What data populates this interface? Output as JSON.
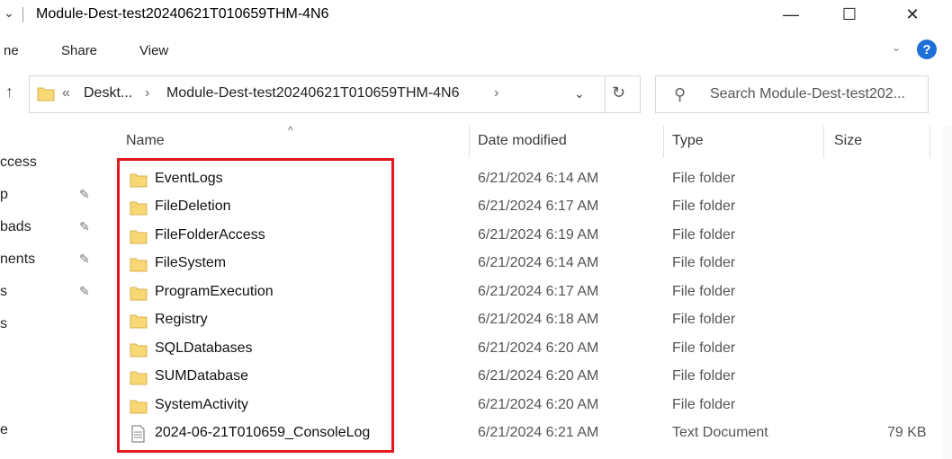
{
  "window": {
    "title": "Module-Dest-test20240621T010659THM-4N6",
    "minimize_glyph": "—",
    "maximize_glyph": "☐",
    "close_glyph": "✕"
  },
  "ribbon": {
    "tabs": [
      {
        "label": "ne"
      },
      {
        "label": "Share"
      },
      {
        "label": "View"
      }
    ],
    "help_glyph": "?"
  },
  "address": {
    "breadcrumbs": [
      "«",
      "Deskt...",
      "›",
      "Module-Dest-test20240621T010659THM-4N6",
      "›"
    ],
    "dropdown_glyph": "⌄",
    "refresh_glyph": "↻"
  },
  "search": {
    "placeholder": "Search Module-Dest-test202..."
  },
  "sidebar": {
    "items": [
      {
        "label": "ccess"
      },
      {
        "label": "p"
      },
      {
        "label": "bads"
      },
      {
        "label": "nents"
      },
      {
        "label": "s"
      },
      {
        "label": "s"
      },
      {
        "label": "e"
      }
    ]
  },
  "columns": {
    "name": "Name",
    "date": "Date modified",
    "type": "Type",
    "size": "Size"
  },
  "files": [
    {
      "name": "EventLogs",
      "date": "6/21/2024 6:14 AM",
      "type": "File folder",
      "size": "",
      "icon": "folder-icon"
    },
    {
      "name": "FileDeletion",
      "date": "6/21/2024 6:17 AM",
      "type": "File folder",
      "size": "",
      "icon": "folder-icon"
    },
    {
      "name": "FileFolderAccess",
      "date": "6/21/2024 6:19 AM",
      "type": "File folder",
      "size": "",
      "icon": "folder-icon"
    },
    {
      "name": "FileSystem",
      "date": "6/21/2024 6:14 AM",
      "type": "File folder",
      "size": "",
      "icon": "folder-icon"
    },
    {
      "name": "ProgramExecution",
      "date": "6/21/2024 6:17 AM",
      "type": "File folder",
      "size": "",
      "icon": "folder-icon"
    },
    {
      "name": "Registry",
      "date": "6/21/2024 6:18 AM",
      "type": "File folder",
      "size": "",
      "icon": "folder-icon"
    },
    {
      "name": "SQLDatabases",
      "date": "6/21/2024 6:20 AM",
      "type": "File folder",
      "size": "",
      "icon": "folder-icon"
    },
    {
      "name": "SUMDatabase",
      "date": "6/21/2024 6:20 AM",
      "type": "File folder",
      "size": "",
      "icon": "folder-icon"
    },
    {
      "name": "SystemActivity",
      "date": "6/21/2024 6:20 AM",
      "type": "File folder",
      "size": "",
      "icon": "folder-icon"
    },
    {
      "name": "2024-06-21T010659_ConsoleLog",
      "date": "6/21/2024 6:21 AM",
      "type": "Text Document",
      "size": "79 KB",
      "icon": "text-file-icon"
    }
  ],
  "colors": {
    "highlight": "#e3161d",
    "folder": "#f8d775",
    "help": "#1e6fd6"
  }
}
